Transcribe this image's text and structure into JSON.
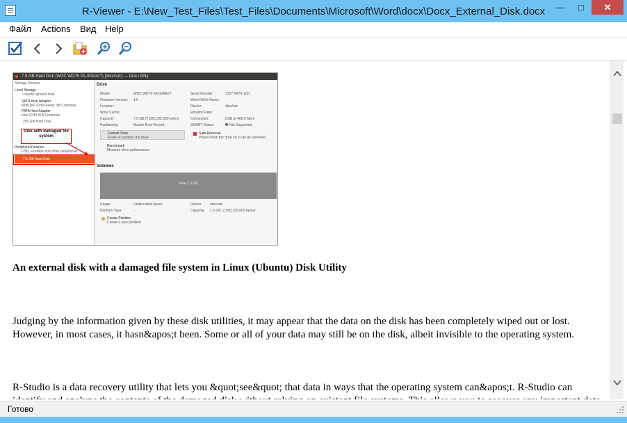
{
  "window": {
    "title": "R-Viewer - E:\\New_Test_Files\\Test_Files\\Documents\\Microsoft\\Word\\docx\\Docx_External_Disk.docx"
  },
  "menu": [
    "Файл",
    "Actions",
    "Вид",
    "Help"
  ],
  "toolbar": {
    "icons": [
      "checkbox-icon",
      "back-arrow-icon",
      "forward-arrow-icon",
      "open-folder-icon",
      "zoom-in-icon",
      "zoom-out-icon"
    ]
  },
  "embedded_screenshot": {
    "title": "7.5 GB Hard Disk (WDC WD75 0A-00AAVT) [/dev/sdc] — Disk Utility",
    "sidebar_header": "Storage Devices",
    "local_storage": "Local Storage",
    "local_storage_sub": "~ubuntu~ground host",
    "sata_adapter_1": "SATA Host Adapter",
    "sata_adapter_1_sub": "82801IR ICH9 Family SB Controller",
    "sata_adapter_2": "PATA Host Adapter",
    "sata_adapter_2_sub": "Intel ICH9 ATA Controller",
    "hard_disk_item": "250 GB Hard Disk",
    "peripheral": "Peripheral Devices",
    "peripheral_sub": "USB, FireWire and other peripherals",
    "selected_disk": "7.5 GB Hard Disk",
    "callout": "Disk with damaged file system",
    "drive_header": "Drive",
    "drive_labels": [
      "Model:",
      "Firmware Version:",
      "Location:",
      "Write Cache:",
      "Capacity:",
      "Partitioning:"
    ],
    "drive_values": [
      "WDC WD75 0A-00AAVT",
      "1.0",
      "",
      "",
      "7.5 GB (7,500,195,600 bytes)",
      "Master Boot Record"
    ],
    "drive_labels_right": [
      "Serial Number:",
      "World Wide Name:",
      "Device:",
      "Rotation Rate:",
      "Connection:",
      "SMART Status:"
    ],
    "drive_values_right": [
      "2157 5A74 1CD",
      "",
      "/dev/sdc",
      "",
      "USB at 480.0 Mb/s",
      "Not Supported"
    ],
    "format_drive": "Format Drive",
    "format_drive_sub": "Erase or partition the drive",
    "safe_removal": "Safe Removal",
    "safe_removal_sub": "Power down the drive so it can be removed",
    "benchmark": "Benchmark",
    "benchmark_sub": "Measure drive performance",
    "volumes_header": "Volumes",
    "volume_bar_text": "Free\n7.5 GB",
    "volume_labels": [
      "Usage:",
      "Partition Type:"
    ],
    "volume_values": [
      "Unallocated Space",
      "-"
    ],
    "volume_labels_right": [
      "Device:",
      "Capacity:"
    ],
    "volume_values_right": [
      "/dev/sdc",
      "7.5 GB (7,500,195,600 bytes)"
    ],
    "create_partition": "Create Partition",
    "create_partition_sub": "Create a new partition"
  },
  "document": {
    "caption": "An external disk with a damaged file system in Linux (Ubuntu) Disk Utility",
    "paragraph1": "Judging by the information given by these disk utilities, it may appear that the data on the disk has been completely wiped out or lost. However, in most cases, it hasn&apos;t been. Some or all of your data may still be on the disk, albeit invisible to the operating system.",
    "paragraph2": "R-Studio is a data recovery utility that lets you &quot;see&quot; that data in ways that the operating system can&apos;t. R-Studio can identify and analyze the contents of the damaged disk without relying on existent file systems. This allows you to recover any important data"
  },
  "status": {
    "text": "Готово"
  }
}
